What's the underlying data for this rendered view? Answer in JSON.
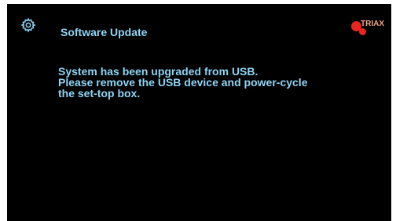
{
  "header": {
    "icon": "gear-icon",
    "title": "Software Update",
    "logo_text": "TRIAX"
  },
  "message": {
    "lines": [
      "System has been upgraded from USB.",
      "Please remove the USB device and power-cycle",
      "the set-top box."
    ]
  },
  "colors": {
    "background": "#000000",
    "text": "#8fd4f4",
    "logo_red": "#e8251e"
  }
}
